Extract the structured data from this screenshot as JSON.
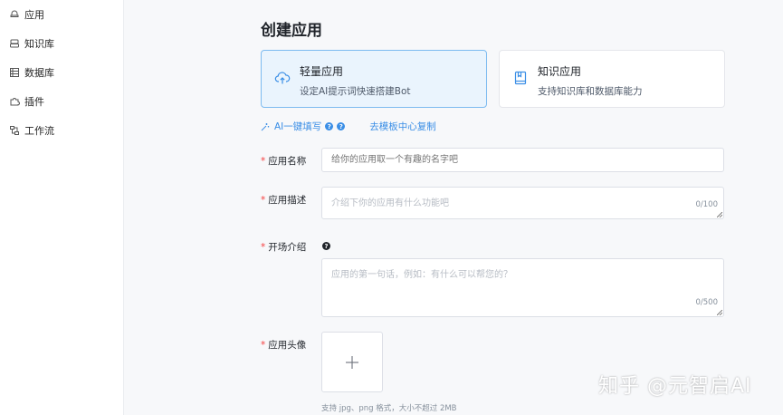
{
  "sidebar": {
    "items": [
      {
        "label": "应用",
        "icon": "app-icon"
      },
      {
        "label": "知识库",
        "icon": "knowledge-icon"
      },
      {
        "label": "数据库",
        "icon": "database-icon"
      },
      {
        "label": "插件",
        "icon": "plugin-icon"
      },
      {
        "label": "工作流",
        "icon": "workflow-icon"
      }
    ]
  },
  "page": {
    "title": "创建应用"
  },
  "app_types": [
    {
      "title": "轻量应用",
      "desc": "设定AI提示词快速搭建Bot",
      "icon": "cloud-upload-icon",
      "selected": true
    },
    {
      "title": "知识应用",
      "desc": "支持知识库和数据库能力",
      "icon": "book-icon",
      "selected": false
    }
  ],
  "assist": {
    "ai_fill_label": "AI一键填写",
    "template_link": "去模板中心复制"
  },
  "form": {
    "name": {
      "label": "应用名称",
      "placeholder": "给你的应用取一个有趣的名字吧",
      "value": ""
    },
    "description": {
      "label": "应用描述",
      "placeholder": "介绍下你的应用有什么功能吧",
      "counter": "0/100",
      "value": ""
    },
    "intro": {
      "label": "开场介绍",
      "placeholder": "应用的第一句话，例如：有什么可以帮您的？",
      "counter": "0/500",
      "value": ""
    },
    "avatar": {
      "label": "应用头像",
      "hint": "支持 jpg、png 格式，大小不超过 2MB"
    }
  },
  "watermark": "知乎 @元智启AI",
  "colors": {
    "accent": "#3a8ee6",
    "selected_card_bg": "#eaf4fd",
    "required": "#f53f3f"
  }
}
